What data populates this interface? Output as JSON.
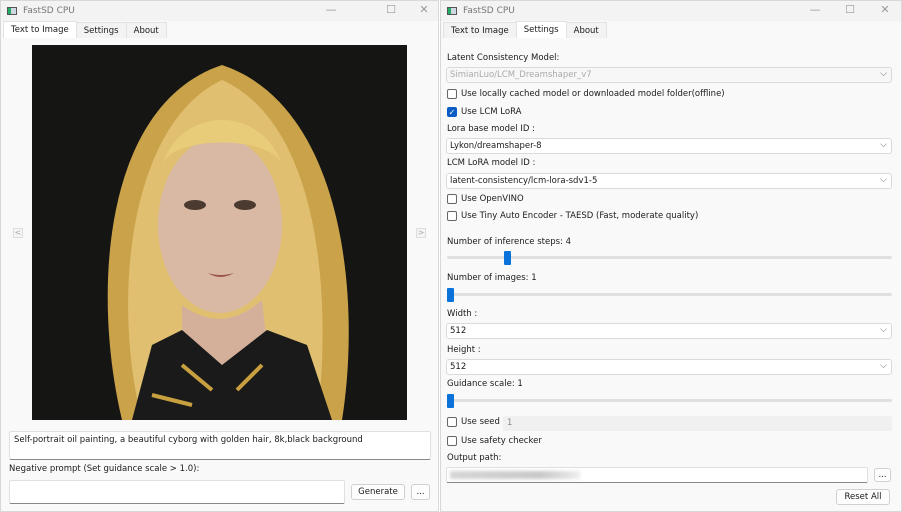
{
  "left_window": {
    "title": "FastSD CPU",
    "tabs": [
      {
        "label": "Text to Image",
        "active": true
      },
      {
        "label": "Settings",
        "active": false
      },
      {
        "label": "About",
        "active": false
      }
    ],
    "image_alt_icon": "generated-portrait",
    "prev_label": "<",
    "next_label": ">",
    "prompt": "Self-portrait oil painting, a beautiful cyborg with golden hair, 8k,black background",
    "negative_prompt_label": "Negative prompt (Set guidance scale > 1.0):",
    "negative_prompt": "",
    "generate_label": "Generate",
    "more_label": "..."
  },
  "right_window": {
    "title": "FastSD CPU",
    "tabs": [
      {
        "label": "Text to Image",
        "active": false
      },
      {
        "label": "Settings",
        "active": true
      },
      {
        "label": "About",
        "active": false
      }
    ],
    "lcm_model_label": "Latent Consistency Model:",
    "lcm_model_value": "SimianLuo/LCM_Dreamshaper_v7",
    "use_local_label": "Use locally cached model or downloaded model folder(offline)",
    "use_local": false,
    "use_lcm_lora_label": "Use LCM LoRA",
    "use_lcm_lora": true,
    "lora_base_label": "Lora base model ID :",
    "lora_base_value": "Lykon/dreamshaper-8",
    "lcm_lora_label": "LCM LoRA model ID :",
    "lcm_lora_value": "latent-consistency/lcm-lora-sdv1-5",
    "openvino_label": "Use OpenVINO",
    "openvino": false,
    "taesd_label": "Use Tiny Auto Encoder - TAESD (Fast, moderate quality)",
    "taesd": false,
    "steps_label": "Number of inference steps: 4",
    "steps_fill": 0.13,
    "images_label": "Number of images: 1",
    "images_fill": 0.0,
    "width_label": "Width :",
    "width_value": "512",
    "height_label": "Height :",
    "height_value": "512",
    "guidance_label": "Guidance scale: 1",
    "guidance_fill": 0.0,
    "use_seed_label": "Use seed",
    "use_seed": false,
    "seed_value": "1",
    "safety_label": "Use safety checker",
    "safety": false,
    "output_path_label": "Output path:",
    "browse_label": "...",
    "reset_label": "Reset All"
  },
  "colors": {
    "accent": "#0a72d8",
    "checkbox_on": "#0b5cc4"
  }
}
